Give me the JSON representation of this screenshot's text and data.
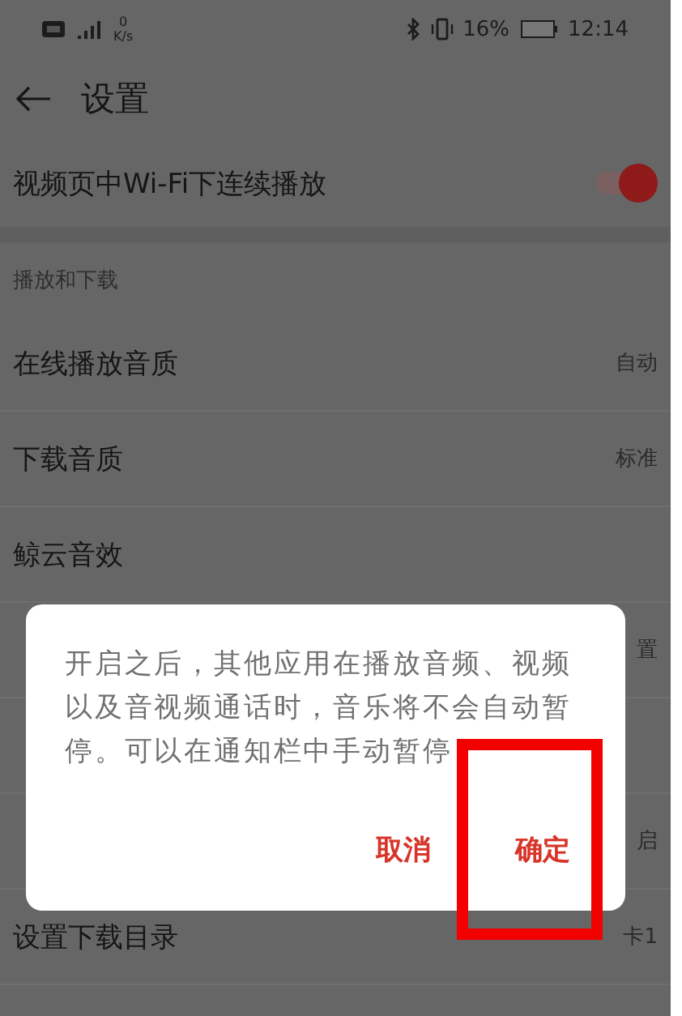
{
  "status_bar": {
    "speed_value": "0",
    "speed_unit": "K/s",
    "battery": "16%",
    "time": "12:14"
  },
  "header": {
    "title": "设置"
  },
  "wifi_row": {
    "label": "视频页中Wi-Fi下连续播放",
    "on": true
  },
  "section": {
    "title": "播放和下载"
  },
  "rows": [
    {
      "label": "在线播放音质",
      "value": "自动"
    },
    {
      "label": "下载音质",
      "value": "标准"
    },
    {
      "label": "鲸云音效"
    },
    {
      "value": "置"
    },
    {},
    {
      "value": "启"
    },
    {
      "label": "设置下载目录",
      "value": "卡1"
    }
  ],
  "dialog": {
    "message": "开启之后，其他应用在播放音频、视频以及音视频通话时，音乐将不会自动暂停。可以在通知栏中手动暂停",
    "buttons": [
      {
        "label": "取消",
        "highlighted": false
      },
      {
        "label": "确定",
        "highlighted": true
      }
    ]
  }
}
